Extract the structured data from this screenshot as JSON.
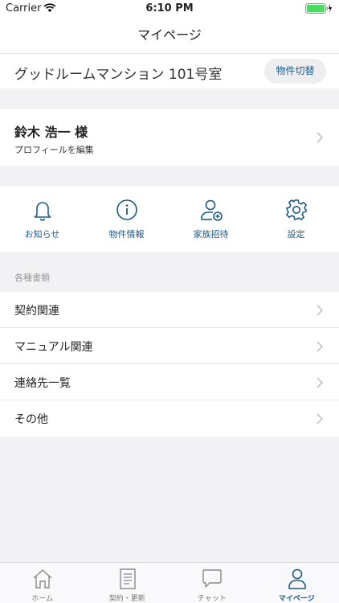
{
  "status_bar": {
    "carrier": "Carrier",
    "time": "6:10 PM"
  },
  "nav": {
    "title": "マイページ"
  },
  "property": {
    "name": "グッドルームマンション 101号室",
    "switch_label": "物件切替"
  },
  "profile": {
    "name": "鈴木 浩一 様",
    "edit_label": "プロフィールを編集"
  },
  "shortcuts": [
    {
      "label": "お知らせ",
      "icon": "bell-icon"
    },
    {
      "label": "物件情報",
      "icon": "info-icon"
    },
    {
      "label": "家族招待",
      "icon": "add-user-icon"
    },
    {
      "label": "設定",
      "icon": "gear-icon"
    }
  ],
  "documents": {
    "header": "各種書類",
    "items": [
      "契約関連",
      "マニュアル関連",
      "連絡先一覧",
      "その他"
    ]
  },
  "tabs": [
    {
      "label": "ホーム",
      "icon": "home-icon"
    },
    {
      "label": "契約・更新",
      "icon": "document-icon"
    },
    {
      "label": "チャット",
      "icon": "chat-icon"
    },
    {
      "label": "マイページ",
      "icon": "person-icon"
    }
  ],
  "colors": {
    "accent": "#1c5a84",
    "background": "#f2f2f4",
    "battery": "#4cd964"
  }
}
